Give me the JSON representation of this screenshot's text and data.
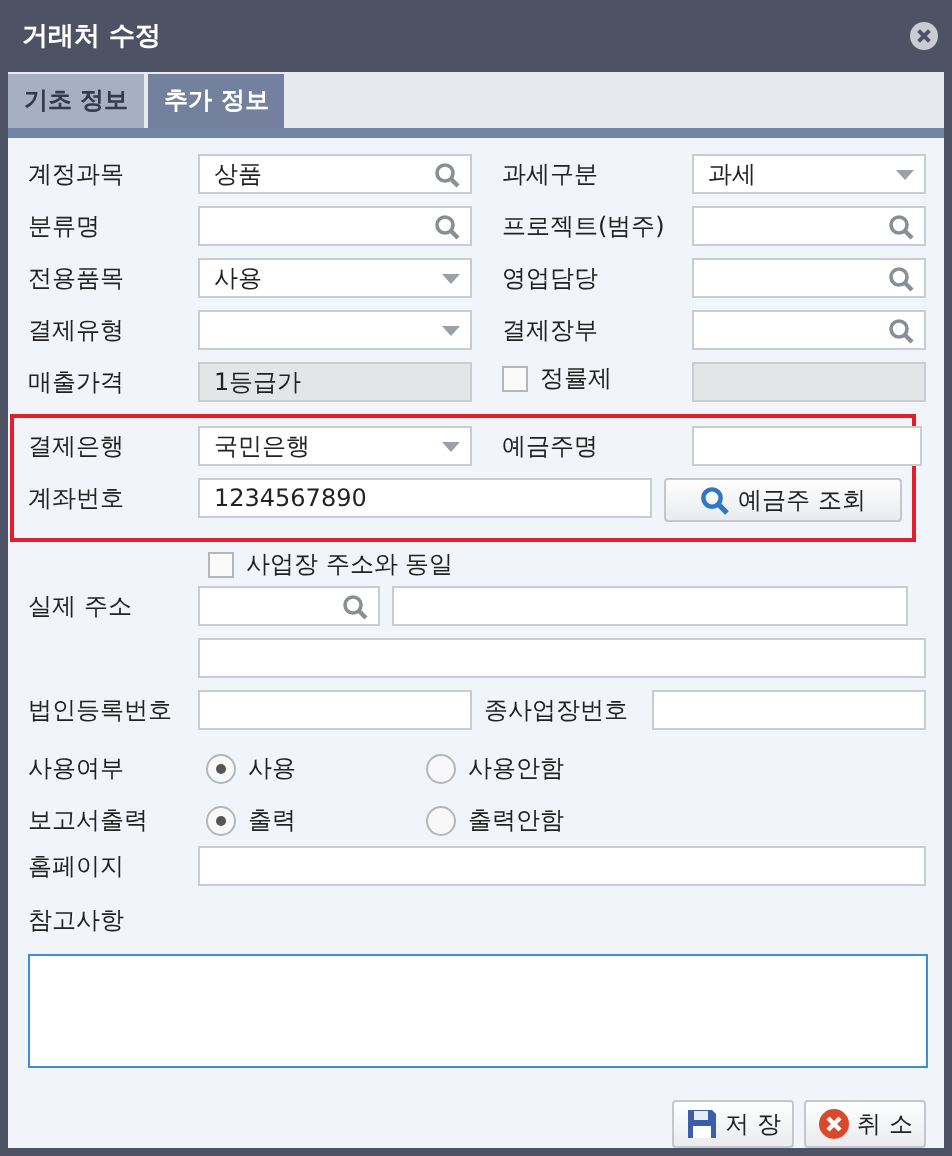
{
  "window": {
    "title": "거래처 수정"
  },
  "tabs": [
    {
      "label": "기초 정보",
      "selected": false
    },
    {
      "label": "추가 정보",
      "selected": true
    }
  ],
  "sections": [
    {
      "highlighted": false,
      "rows": [
        {
          "kind": "pair",
          "items": [
            {
              "kind": "label",
              "text": "계정과목"
            },
            {
              "kind": "search",
              "value": "상품"
            },
            {
              "kind": "label",
              "text": "과세구분"
            },
            {
              "kind": "select",
              "value": "과세"
            }
          ]
        },
        {
          "kind": "pair",
          "items": [
            {
              "kind": "label",
              "text": "분류명"
            },
            {
              "kind": "search"
            },
            {
              "kind": "label",
              "text": "프로젝트(범주)"
            },
            {
              "kind": "search"
            }
          ]
        },
        {
          "kind": "pair",
          "items": [
            {
              "kind": "label",
              "text": "전용품목"
            },
            {
              "kind": "select",
              "value": "사용"
            },
            {
              "kind": "label",
              "text": "영업담당"
            },
            {
              "kind": "search"
            }
          ]
        },
        {
          "kind": "pair",
          "items": [
            {
              "kind": "label",
              "text": "결제유형"
            },
            {
              "kind": "select"
            },
            {
              "kind": "label",
              "text": "결제장부"
            },
            {
              "kind": "search"
            }
          ]
        },
        {
          "kind": "pair",
          "items": [
            {
              "kind": "label",
              "text": "매출가격"
            },
            {
              "kind": "readonly",
              "value": "1등급가"
            },
            {
              "kind": "check",
              "text": "정률제",
              "checked": false
            },
            {
              "kind": "readonly"
            }
          ]
        }
      ]
    },
    {
      "highlighted": true,
      "rows": [
        {
          "kind": "pair",
          "items": [
            {
              "kind": "label",
              "text": "결제은행"
            },
            {
              "kind": "select",
              "value": "국민은행"
            },
            {
              "kind": "label",
              "text": "예금주명"
            },
            {
              "kind": "text"
            }
          ]
        },
        {
          "kind": "account",
          "items": [
            {
              "kind": "label",
              "text": "계좌번호"
            },
            {
              "kind": "text",
              "value": "1234567890"
            },
            {
              "kind": "button",
              "text": "예금주 조회"
            }
          ]
        }
      ]
    },
    {
      "highlighted": false,
      "rows": [
        {
          "kind": "check",
          "items": [
            {
              "kind": "check",
              "text": "사업장 주소와 동일",
              "checked": false
            }
          ]
        },
        {
          "kind": "address",
          "items": [
            {
              "kind": "label",
              "text": "실제 주소"
            },
            {
              "kind": "search"
            },
            {
              "kind": "text"
            }
          ]
        },
        {
          "kind": "line",
          "items": [
            {
              "kind": "text"
            }
          ]
        },
        {
          "kind": "wide",
          "items": [
            {
              "kind": "label",
              "text": "법인등록번호"
            },
            {
              "kind": "text"
            },
            {
              "kind": "label",
              "text": "종사업장번호"
            },
            {
              "kind": "text"
            }
          ]
        },
        {
          "kind": "radio",
          "items": [
            {
              "kind": "label",
              "text": "사용여부"
            },
            {
              "kind": "radio",
              "text": "사용",
              "selected": true
            },
            {
              "kind": "radio",
              "text": "사용안함",
              "selected": false
            }
          ]
        },
        {
          "kind": "radio",
          "items": [
            {
              "kind": "label",
              "text": "보고서출력"
            },
            {
              "kind": "radio",
              "text": "출력",
              "selected": true
            },
            {
              "kind": "radio",
              "text": "출력안함",
              "selected": false
            }
          ]
        },
        {
          "kind": "line",
          "items": [
            {
              "kind": "label",
              "text": "홈페이지"
            },
            {
              "kind": "text"
            }
          ]
        },
        {
          "kind": "note",
          "items": [
            {
              "kind": "label",
              "text": "참고사항"
            },
            {
              "kind": "memo"
            }
          ]
        }
      ]
    }
  ],
  "buttons": [
    {
      "kind": "save",
      "label": "저 장"
    },
    {
      "kind": "cancel",
      "label": "취 소"
    }
  ]
}
